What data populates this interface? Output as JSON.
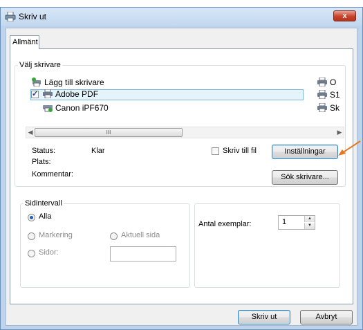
{
  "window": {
    "title": "Skriv ut",
    "close_glyph": "x"
  },
  "tabs": [
    {
      "label": "Allmänt",
      "active": true
    }
  ],
  "select_printer": {
    "legend": "Välj skrivare",
    "printers": [
      {
        "name": "Lägg till skrivare",
        "icon": "add-printer-icon",
        "checked": false
      },
      {
        "name": "Adobe PDF",
        "icon": "printer-icon",
        "checked": true,
        "selected": true
      },
      {
        "name": "Canon iPF670",
        "icon": "network-printer-icon",
        "checked": false
      }
    ],
    "right_column": [
      "O",
      "S1",
      "Sk"
    ],
    "scroll_grip": "III"
  },
  "status": {
    "status_label": "Status:",
    "status_value": "Klar",
    "location_label": "Plats:",
    "comment_label": "Kommentar:",
    "print_to_file_label": "Skriv till fil",
    "print_to_file_checked": false,
    "settings_button": "Inställningar",
    "find_printer_button": "Sök skrivare..."
  },
  "page_range": {
    "legend": "Sidintervall",
    "options": {
      "all": "Alla",
      "selection": "Markering",
      "current_page": "Aktuell sida",
      "pages": "Sidor:"
    },
    "selected": "all",
    "pages_value": ""
  },
  "copies": {
    "label": "Antal exemplar:",
    "value": "1"
  },
  "footer": {
    "print_button": "Skriv ut",
    "cancel_button": "Avbryt"
  },
  "colors": {
    "annotation_arrow": "#e87722",
    "selection_fill": "#e5f3fb",
    "title_bar": "#c8dcf1"
  }
}
